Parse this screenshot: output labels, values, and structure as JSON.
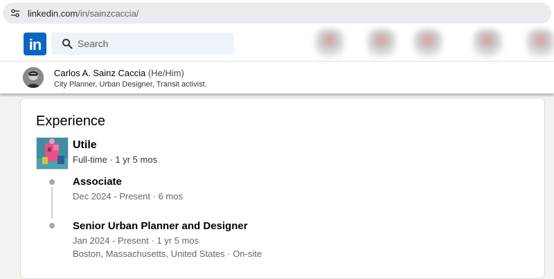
{
  "browser": {
    "url_host": "linkedin.com",
    "url_path": "/in/sainzcaccia/",
    "site_info_icon": "tune-icon"
  },
  "nav": {
    "logo_text": "in",
    "search_placeholder": "Search",
    "brand_color": "#0a66c2"
  },
  "profile": {
    "name": "Carlos A. Sainz Caccia",
    "pronouns": "(He/Him)",
    "headline": "City Planner, Urban Designer, Transit activist."
  },
  "experience": {
    "title": "Experience",
    "company": {
      "name": "Utile",
      "meta": "Full-time · 1 yr 5 mos"
    },
    "roles": [
      {
        "title": "Associate",
        "dates": "Dec 2024 - Present · 6 mos"
      },
      {
        "title": "Senior Urban Planner and Designer",
        "dates": "Jan 2024 - Present · 1 yr 5 mos",
        "location": "Boston, Massachusetts, United States · On-site"
      }
    ]
  }
}
